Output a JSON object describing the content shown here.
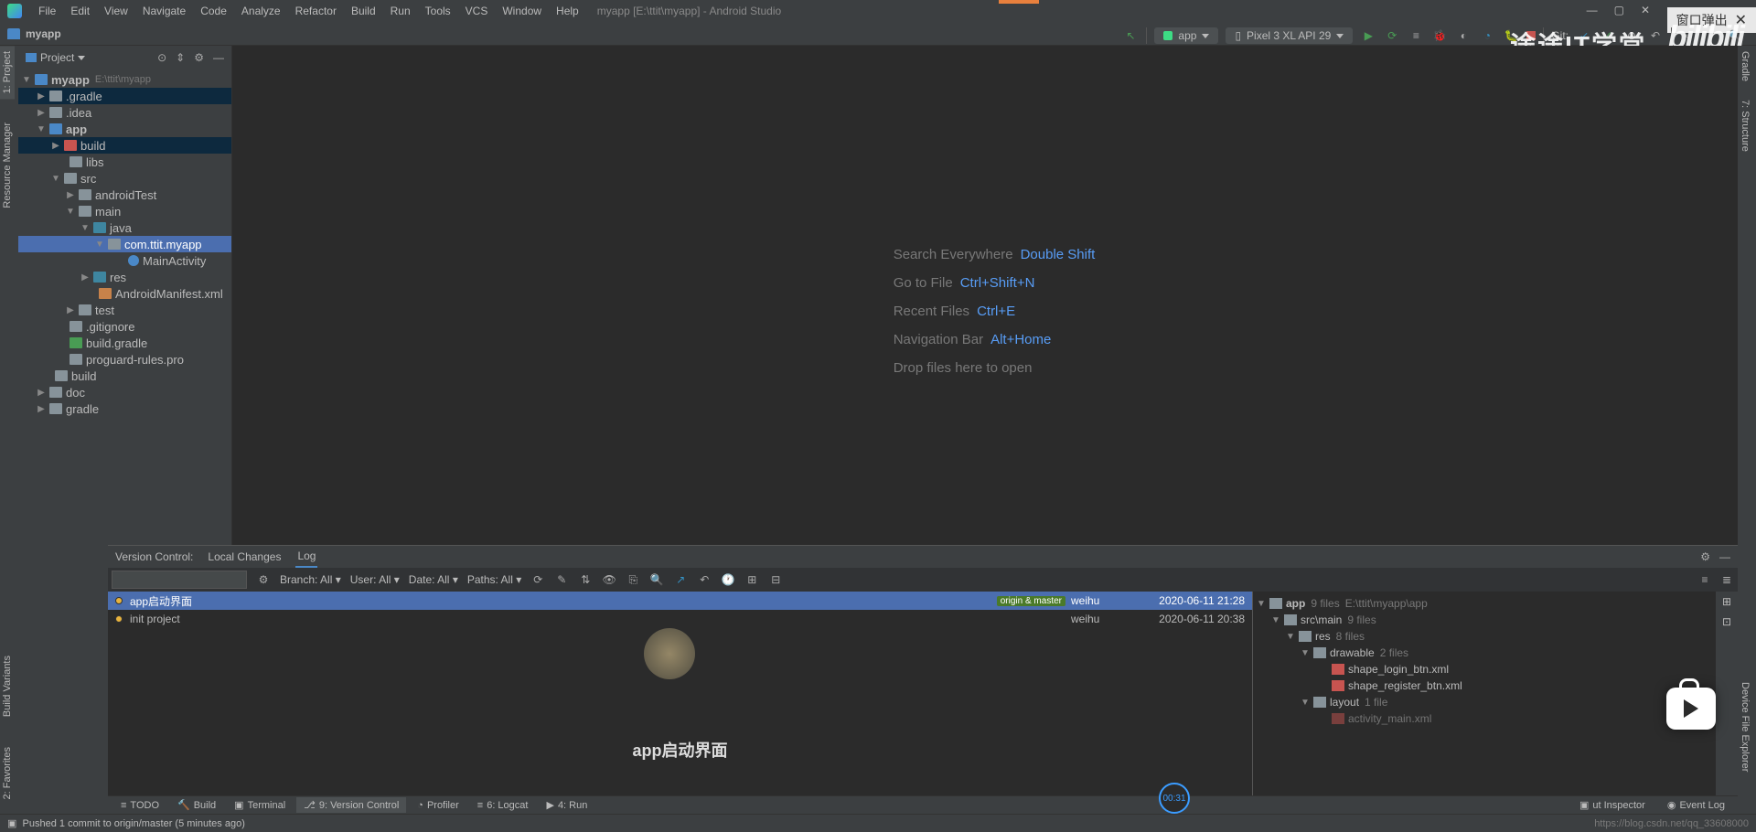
{
  "window": {
    "title": "myapp [E:\\ttit\\myapp] - Android Studio",
    "popup_label": "窗口弹出",
    "menu": [
      "File",
      "Edit",
      "View",
      "Navigate",
      "Code",
      "Analyze",
      "Refactor",
      "Build",
      "Run",
      "Tools",
      "VCS",
      "Window",
      "Help"
    ]
  },
  "navbar": {
    "project": "myapp"
  },
  "run_config": {
    "app_label": "app",
    "device_label": "Pixel 3 XL API 29",
    "git_label": "Git:"
  },
  "left_tabs": {
    "project": "1: Project",
    "rm": "Resource Manager",
    "bv": "Build Variants",
    "fav": "2: Favorites"
  },
  "right_tabs": {
    "gradle": "Gradle",
    "structure": "7: Structure",
    "dfe": "Device File Explorer"
  },
  "project_panel": {
    "header": "Project",
    "tree": {
      "root": "myapp",
      "root_path": "E:\\ttit\\myapp",
      "gradle_dir": ".gradle",
      "idea_dir": ".idea",
      "app_dir": "app",
      "build_dir": "build",
      "libs_dir": "libs",
      "src_dir": "src",
      "androidTest": "androidTest",
      "main_dir": "main",
      "java_dir": "java",
      "pkg": "com.ttit.myapp",
      "main_activity": "MainActivity",
      "res_dir": "res",
      "manifest": "AndroidManifest.xml",
      "test_dir": "test",
      "gitignore": ".gitignore",
      "build_gradle": "build.gradle",
      "proguard": "proguard-rules.pro",
      "build2": "build",
      "doc": "doc",
      "gradle2": "gradle"
    }
  },
  "editor_hints": {
    "se": "Search Everywhere",
    "se_key": "Double Shift",
    "gf": "Go to File",
    "gf_key": "Ctrl+Shift+N",
    "rf": "Recent Files",
    "rf_key": "Ctrl+E",
    "nb": "Navigation Bar",
    "nb_key": "Alt+Home",
    "drop": "Drop files here to open"
  },
  "vc": {
    "label": "Version Control:",
    "tabs": {
      "local": "Local Changes",
      "log": "Log"
    },
    "filters": {
      "branch_l": "Branch:",
      "branch_v": "All",
      "user_l": "User:",
      "user_v": "All",
      "date_l": "Date:",
      "date_v": "All",
      "paths_l": "Paths:",
      "paths_v": "All"
    },
    "commits": [
      {
        "msg": "app启动界面",
        "branches": "origin & master",
        "author": "weihu",
        "date": "2020-06-11 21:28"
      },
      {
        "msg": "init project",
        "branches": "",
        "author": "weihu",
        "date": "2020-06-11 20:38"
      }
    ],
    "commit_title": "app启动界面",
    "detail": {
      "app": "app",
      "app_meta": "9 files",
      "app_path": "E:\\ttit\\myapp\\app",
      "srcmain": "src\\main",
      "srcmain_meta": "9 files",
      "res": "res",
      "res_meta": "8 files",
      "drawable": "drawable",
      "drawable_meta": "2 files",
      "f1": "shape_login_btn.xml",
      "f2": "shape_register_btn.xml",
      "layout": "layout",
      "layout_meta": "1 file",
      "f3": "activity_main.xml"
    }
  },
  "toolstrip": {
    "todo": "TODO",
    "build": "Build",
    "terminal": "Terminal",
    "vc": "9: Version Control",
    "profiler": "Profiler",
    "logcat": "6: Logcat",
    "run": "4: Run",
    "layout_inspector": "ut Inspector",
    "event_log": "Event Log"
  },
  "status": {
    "msg": "Pushed 1 commit to origin/master (5 minutes ago)",
    "url": "https://blog.csdn.net/qq_33608000"
  },
  "watermarks": {
    "w1": "途途IT学堂",
    "w2": "bilibili"
  },
  "time_badge": "00:31"
}
